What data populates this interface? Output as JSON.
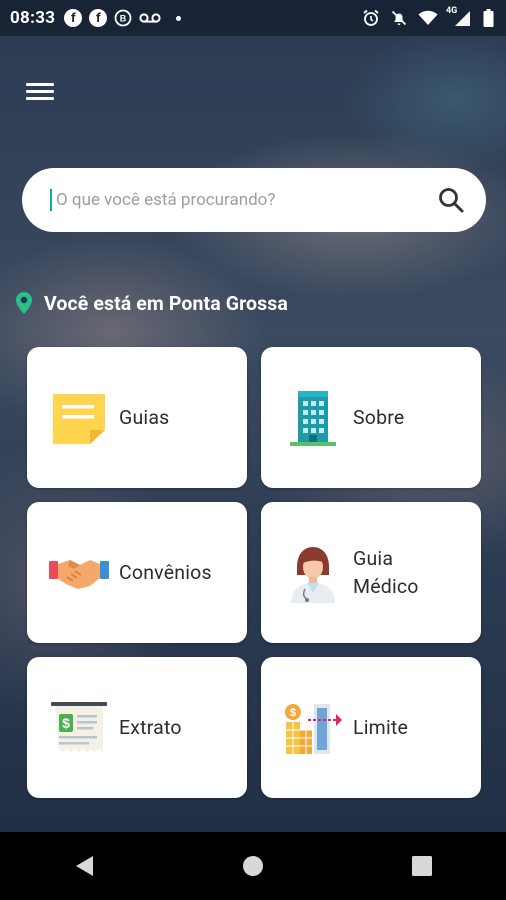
{
  "status_bar": {
    "time": "08:33",
    "network": "4G"
  },
  "search": {
    "placeholder": "O que você está procurando?"
  },
  "location": {
    "text": "Você está em Ponta Grossa"
  },
  "cards": [
    {
      "label": "Guias",
      "icon": "sticky-note-icon"
    },
    {
      "label": "Sobre",
      "icon": "building-icon"
    },
    {
      "label": "Convênios",
      "icon": "handshake-icon"
    },
    {
      "label": "Guia\nMédico",
      "icon": "doctor-icon"
    },
    {
      "label": "Extrato",
      "icon": "receipt-icon"
    },
    {
      "label": "Limite",
      "icon": "limit-chart-icon"
    }
  ],
  "colors": {
    "accent": "#1aa6a0",
    "pin": "#2bbf8a",
    "card_bg": "#ffffff"
  }
}
